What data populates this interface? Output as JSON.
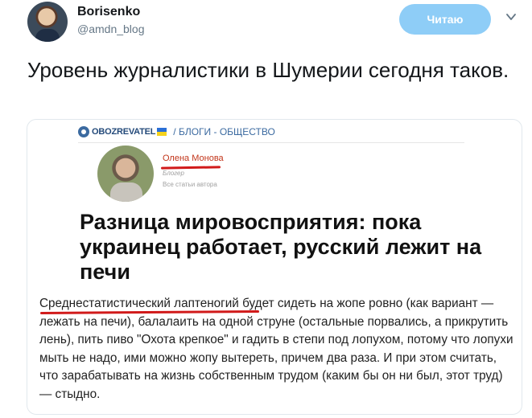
{
  "tweet": {
    "display_name": "Borisenko",
    "handle": "@amdn_blog",
    "follow_label": "Читаю",
    "text": "Уровень журналистики в Шумерии сегодня таков."
  },
  "media": {
    "site_name": "OBOZREVATEL",
    "breadcrumb": "/ БЛОГИ - ОБЩЕСТВО",
    "author_name": "Олена Монова",
    "author_role": "Блогер",
    "author_all": "Все статьи автора",
    "headline": "Разница мировосприятия: пока украинец работает, русский лежит на печи",
    "body": "Среднестатистический лаптеногий будет сидеть на жопе ровно (как вариант — лежать на печи), балалаить на одной струне (остальные порвались, а прикрутить лень), пить пиво \"Охота крепкое\" и гадить в степи под лопухом, потому что лопухи мыть не надо, ими можно жопу вытереть, причем два раза. И при этом считать, что зарабатывать на жизнь собственным трудом (каким бы он ни был, этот труд) — стыдно."
  },
  "colors": {
    "follow_bg": "#8ecdf7",
    "underline": "#d11a1a",
    "link_blue": "#3b6aa0"
  },
  "icons": [
    "avatar",
    "chevron-down-icon",
    "obozrevatel-logo-icon"
  ]
}
